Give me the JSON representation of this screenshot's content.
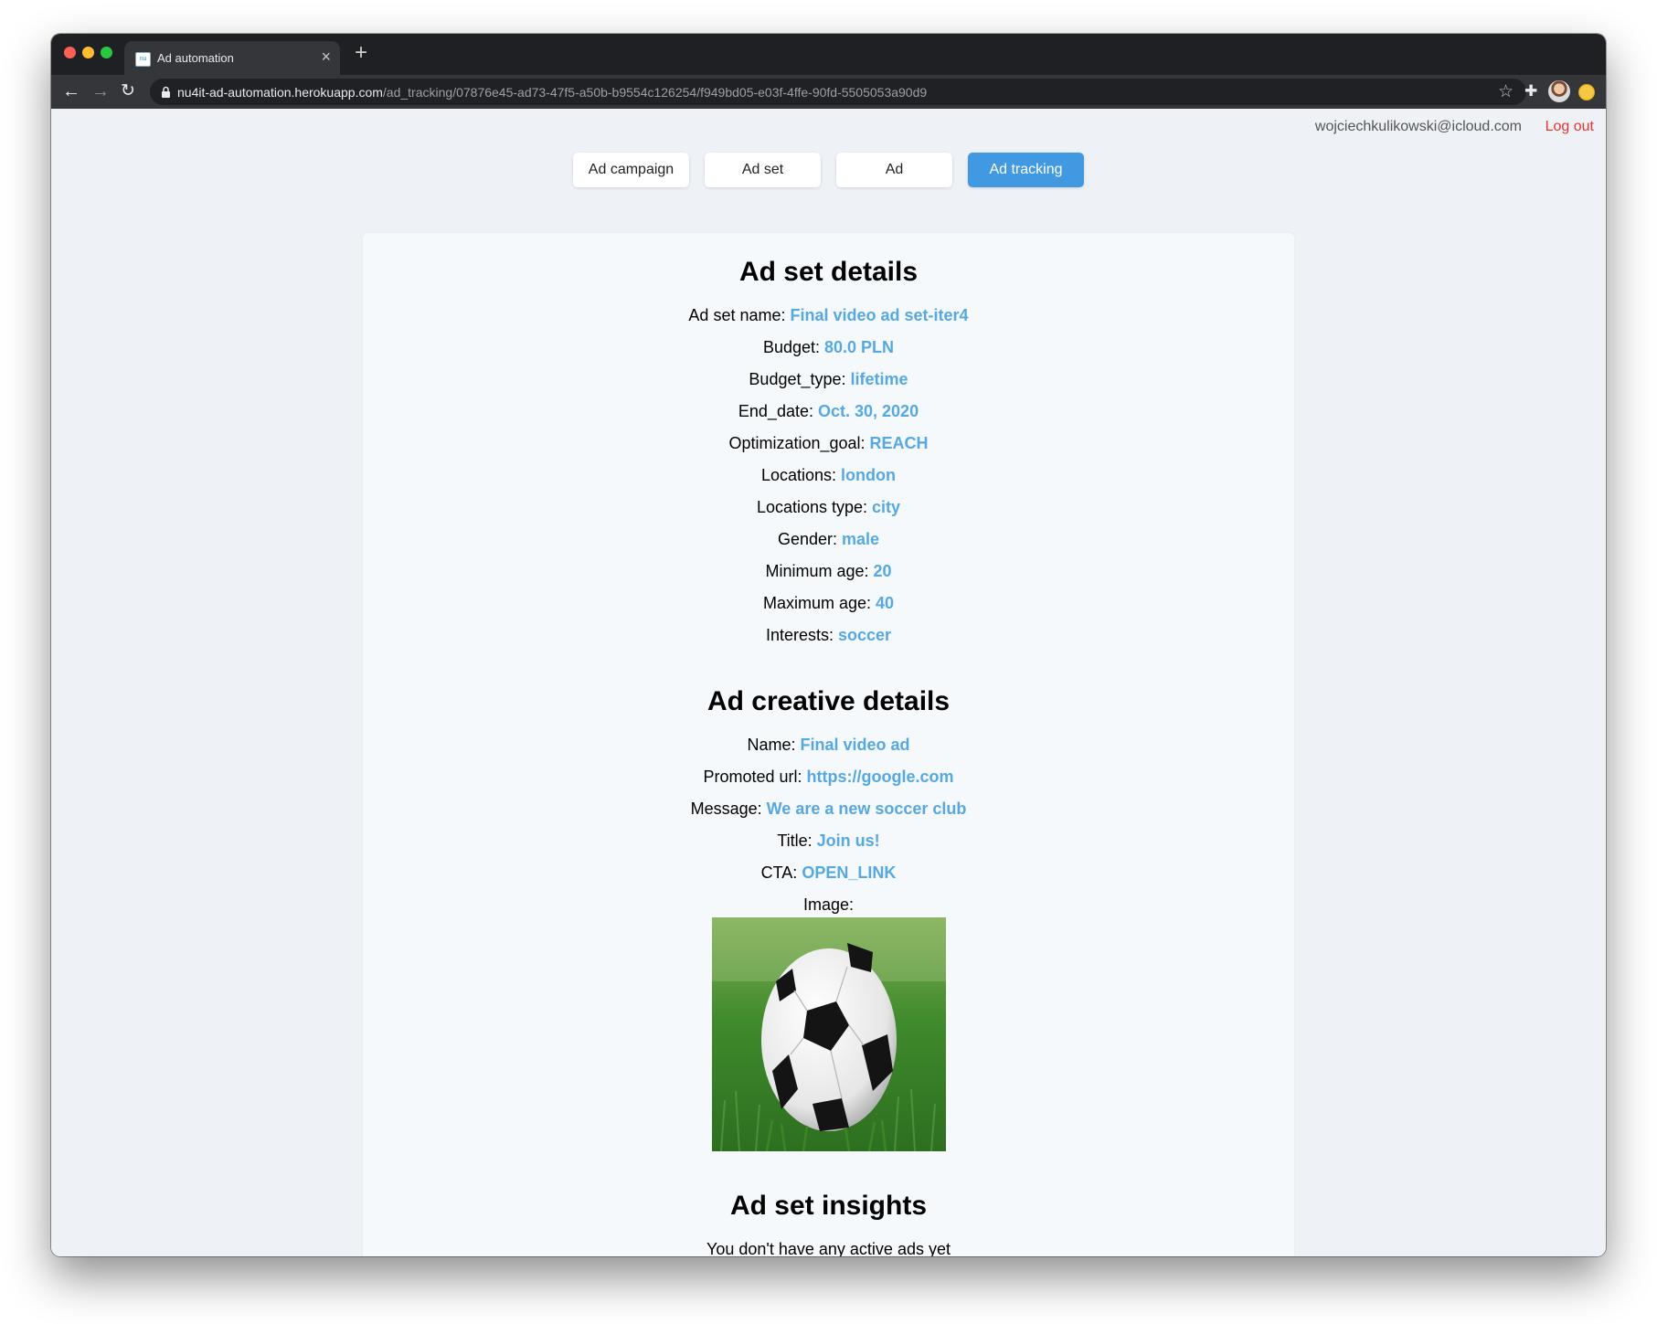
{
  "browser": {
    "tab_title": "Ad automation",
    "favicon_text": "nu",
    "url_host": "nu4it-ad-automation.herokuapp.com",
    "url_path": "/ad_tracking/07876e45-ad73-47f5-a50b-b9554c126254/f949bd05-e03f-4ffe-90fd-5505053a90d9"
  },
  "header": {
    "user_email": "wojciechkulikowski@icloud.com",
    "logout_label": "Log out"
  },
  "nav": [
    {
      "label": "Ad campaign",
      "active": false
    },
    {
      "label": "Ad set",
      "active": false
    },
    {
      "label": "Ad",
      "active": false
    },
    {
      "label": "Ad tracking",
      "active": true
    }
  ],
  "ad_set_details": {
    "title": "Ad set details",
    "rows": [
      {
        "label": "Ad set name:",
        "value": "Final video ad set-iter4"
      },
      {
        "label": "Budget:",
        "value": "80.0 PLN"
      },
      {
        "label": "Budget_type:",
        "value": "lifetime"
      },
      {
        "label": "End_date:",
        "value": "Oct. 30, 2020"
      },
      {
        "label": "Optimization_goal:",
        "value": "REACH"
      },
      {
        "label": "Locations:",
        "value": "london"
      },
      {
        "label": "Locations type:",
        "value": "city"
      },
      {
        "label": "Gender:",
        "value": "male"
      },
      {
        "label": "Minimum age:",
        "value": "20"
      },
      {
        "label": "Maximum age:",
        "value": "40"
      },
      {
        "label": "Interests:",
        "value": "soccer"
      }
    ]
  },
  "ad_creative_details": {
    "title": "Ad creative details",
    "rows": [
      {
        "label": "Name:",
        "value": "Final video ad"
      },
      {
        "label": "Promoted url:",
        "value": "https://google.com"
      },
      {
        "label": "Message:",
        "value": "We are a new soccer club"
      },
      {
        "label": "Title:",
        "value": "Join us!"
      },
      {
        "label": "CTA:",
        "value": "OPEN_LINK"
      }
    ],
    "image_label": "Image:",
    "image_subject": "soccer-ball-on-grass"
  },
  "ad_set_insights": {
    "title": "Ad set insights",
    "message": "You don't have any active ads yet"
  },
  "colors": {
    "accent": "#4199e2",
    "value_text": "#56a8e0",
    "logout": "#e3342f",
    "page_bg": "#eef2f6",
    "card_bg": "#f6f9fb"
  }
}
